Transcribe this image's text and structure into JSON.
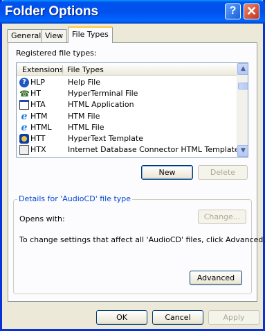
{
  "window": {
    "title": "Folder Options",
    "help_glyph": "?",
    "close_glyph": "✕"
  },
  "tabs": [
    {
      "label": "General"
    },
    {
      "label": "View"
    },
    {
      "label": "File Types",
      "active": true
    }
  ],
  "file_types": {
    "list_label": "Registered file types:",
    "columns": [
      "Extensions",
      "File Types"
    ],
    "rows": [
      {
        "ext": "HLP",
        "type": "Help File",
        "icon": "help-file-icon"
      },
      {
        "ext": "HT",
        "type": "HyperTerminal File",
        "icon": "hyperterminal-icon"
      },
      {
        "ext": "HTA",
        "type": "HTML Application",
        "icon": "html-application-icon"
      },
      {
        "ext": "HTM",
        "type": "HTM File",
        "icon": "internet-explorer-icon"
      },
      {
        "ext": "HTML",
        "type": "HTML File",
        "icon": "internet-explorer-icon"
      },
      {
        "ext": "HTT",
        "type": "HyperText Template",
        "icon": "hypertext-template-icon"
      },
      {
        "ext": "HTX",
        "type": "Internet Database Connector HTML Template",
        "icon": "generic-file-icon"
      }
    ],
    "new_label": "New",
    "delete_label": "Delete"
  },
  "details": {
    "title": "Details for 'AudioCD' file type",
    "opens_with_label": "Opens with:",
    "change_label": "Change...",
    "advanced_text": "To change settings that affect all 'AudioCD' files, click Advanced.",
    "advanced_label": "Advanced"
  },
  "footer": {
    "ok_label": "OK",
    "cancel_label": "Cancel",
    "apply_label": "Apply"
  },
  "colors": {
    "titlebar": "#0054e3",
    "window_face": "#ece9d8",
    "group_title": "#0046d5",
    "tab_highlight": "#ffc83c"
  }
}
